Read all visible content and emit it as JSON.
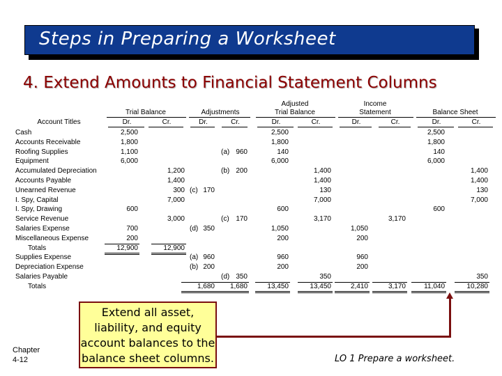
{
  "slide": {
    "title": "Steps in Preparing a Worksheet",
    "subtitle": "4. Extend Amounts to Financial Statement Columns",
    "callout": "Extend all asset, liability, and equity account balances to the balance sheet columns.",
    "chapter_label": "Chapter",
    "chapter_number": "4-12",
    "learning_objective": "LO 1  Prepare a worksheet.",
    "colors": {
      "title_bar": "#0f3a8f",
      "subtitle": "#8b0000",
      "callout_bg": "#ffff99",
      "callout_border": "#7a0f0f"
    }
  },
  "worksheet": {
    "group_headers": {
      "trial_balance": "Trial Balance",
      "adjustments": "Adjustments",
      "adjusted_tb_line1": "Adjusted",
      "adjusted_tb_line2": "Trial Balance",
      "income_statement_line1": "Income",
      "income_statement_line2": "Statement",
      "balance_sheet": "Balance Sheet"
    },
    "account_titles_header": "Account Titles",
    "dr": "Dr.",
    "cr": "Cr.",
    "rows": [
      {
        "account": "Cash",
        "tb_dr": "2,500",
        "tb_cr": "",
        "adj_dr_ref": "",
        "adj_dr": "",
        "adj_cr_ref": "",
        "adj_cr": "",
        "atb_dr": "2,500",
        "atb_cr": "",
        "is_dr": "",
        "is_cr": "",
        "bs_dr": "2,500",
        "bs_cr": ""
      },
      {
        "account": "Accounts Receivable",
        "tb_dr": "1,800",
        "tb_cr": "",
        "adj_dr_ref": "",
        "adj_dr": "",
        "adj_cr_ref": "",
        "adj_cr": "",
        "atb_dr": "1,800",
        "atb_cr": "",
        "is_dr": "",
        "is_cr": "",
        "bs_dr": "1,800",
        "bs_cr": ""
      },
      {
        "account": "Roofing Supplies",
        "tb_dr": "1,100",
        "tb_cr": "",
        "adj_dr_ref": "",
        "adj_dr": "",
        "adj_cr_ref": "(a)",
        "adj_cr": "960",
        "atb_dr": "140",
        "atb_cr": "",
        "is_dr": "",
        "is_cr": "",
        "bs_dr": "140",
        "bs_cr": ""
      },
      {
        "account": "Equipment",
        "tb_dr": "6,000",
        "tb_cr": "",
        "adj_dr_ref": "",
        "adj_dr": "",
        "adj_cr_ref": "",
        "adj_cr": "",
        "atb_dr": "6,000",
        "atb_cr": "",
        "is_dr": "",
        "is_cr": "",
        "bs_dr": "6,000",
        "bs_cr": ""
      },
      {
        "account": "Accumulated Depreciation",
        "tb_dr": "",
        "tb_cr": "1,200",
        "adj_dr_ref": "",
        "adj_dr": "",
        "adj_cr_ref": "(b)",
        "adj_cr": "200",
        "atb_dr": "",
        "atb_cr": "1,400",
        "is_dr": "",
        "is_cr": "",
        "bs_dr": "",
        "bs_cr": "1,400"
      },
      {
        "account": "Accounts Payable",
        "tb_dr": "",
        "tb_cr": "1,400",
        "adj_dr_ref": "",
        "adj_dr": "",
        "adj_cr_ref": "",
        "adj_cr": "",
        "atb_dr": "",
        "atb_cr": "1,400",
        "is_dr": "",
        "is_cr": "",
        "bs_dr": "",
        "bs_cr": "1,400"
      },
      {
        "account": "Unearned Revenue",
        "tb_dr": "",
        "tb_cr": "300",
        "adj_dr_ref": "(c)",
        "adj_dr": "170",
        "adj_cr_ref": "",
        "adj_cr": "",
        "atb_dr": "",
        "atb_cr": "130",
        "is_dr": "",
        "is_cr": "",
        "bs_dr": "",
        "bs_cr": "130"
      },
      {
        "account": "I. Spy, Capital",
        "tb_dr": "",
        "tb_cr": "7,000",
        "adj_dr_ref": "",
        "adj_dr": "",
        "adj_cr_ref": "",
        "adj_cr": "",
        "atb_dr": "",
        "atb_cr": "7,000",
        "is_dr": "",
        "is_cr": "",
        "bs_dr": "",
        "bs_cr": "7,000"
      },
      {
        "account": "I. Spy, Drawing",
        "tb_dr": "600",
        "tb_cr": "",
        "adj_dr_ref": "",
        "adj_dr": "",
        "adj_cr_ref": "",
        "adj_cr": "",
        "atb_dr": "600",
        "atb_cr": "",
        "is_dr": "",
        "is_cr": "",
        "bs_dr": "600",
        "bs_cr": ""
      },
      {
        "account": "Service Revenue",
        "tb_dr": "",
        "tb_cr": "3,000",
        "adj_dr_ref": "",
        "adj_dr": "",
        "adj_cr_ref": "(c)",
        "adj_cr": "170",
        "atb_dr": "",
        "atb_cr": "3,170",
        "is_dr": "",
        "is_cr": "3,170",
        "bs_dr": "",
        "bs_cr": ""
      },
      {
        "account": "Salaries Expense",
        "tb_dr": "700",
        "tb_cr": "",
        "adj_dr_ref": "(d)",
        "adj_dr": "350",
        "adj_cr_ref": "",
        "adj_cr": "",
        "atb_dr": "1,050",
        "atb_cr": "",
        "is_dr": "1,050",
        "is_cr": "",
        "bs_dr": "",
        "bs_cr": ""
      },
      {
        "account": "Miscellaneous Expense",
        "tb_dr": "200",
        "tb_cr": "",
        "adj_dr_ref": "",
        "adj_dr": "",
        "adj_cr_ref": "",
        "adj_cr": "",
        "atb_dr": "200",
        "atb_cr": "",
        "is_dr": "200",
        "is_cr": "",
        "bs_dr": "",
        "bs_cr": ""
      },
      {
        "account": "   Totals",
        "tb_dr": "12,900",
        "tb_cr": "12,900",
        "adj_dr_ref": "",
        "adj_dr": "",
        "adj_cr_ref": "",
        "adj_cr": "",
        "atb_dr": "",
        "atb_cr": "",
        "is_dr": "",
        "is_cr": "",
        "bs_dr": "",
        "bs_cr": "",
        "is_total": true
      },
      {
        "account": "Supplies Expense",
        "tb_dr": "",
        "tb_cr": "",
        "adj_dr_ref": "(a)",
        "adj_dr": "960",
        "adj_cr_ref": "",
        "adj_cr": "",
        "atb_dr": "960",
        "atb_cr": "",
        "is_dr": "960",
        "is_cr": "",
        "bs_dr": "",
        "bs_cr": ""
      },
      {
        "account": "Depreciation Expense",
        "tb_dr": "",
        "tb_cr": "",
        "adj_dr_ref": "(b)",
        "adj_dr": "200",
        "adj_cr_ref": "",
        "adj_cr": "",
        "atb_dr": "200",
        "atb_cr": "",
        "is_dr": "200",
        "is_cr": "",
        "bs_dr": "",
        "bs_cr": ""
      },
      {
        "account": "Salaries Payable",
        "tb_dr": "",
        "tb_cr": "",
        "adj_dr_ref": "",
        "adj_dr": "",
        "adj_cr_ref": "(d)",
        "adj_cr": "350",
        "atb_dr": "",
        "atb_cr": "350",
        "is_dr": "",
        "is_cr": "",
        "bs_dr": "",
        "bs_cr": "350"
      },
      {
        "account": "   Totals",
        "tb_dr": "",
        "tb_cr": "",
        "adj_dr_ref": "",
        "adj_dr": "1,680",
        "adj_cr_ref": "",
        "adj_cr": "1,680",
        "atb_dr": "13,450",
        "atb_cr": "13,450",
        "is_dr": "2,410",
        "is_cr": "3,170",
        "bs_dr": "11,040",
        "bs_cr": "10,280",
        "is_total": true
      }
    ]
  }
}
